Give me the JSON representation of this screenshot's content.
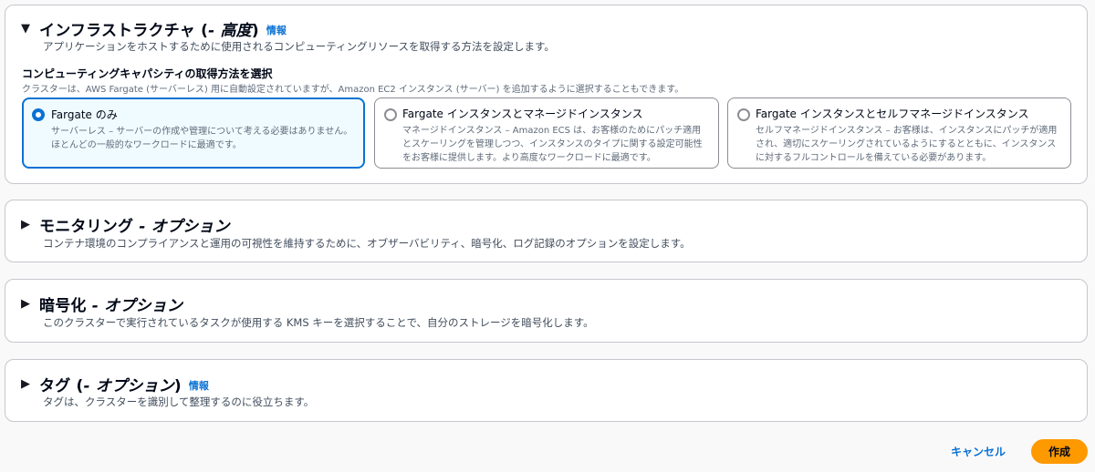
{
  "infrastructure": {
    "caret": "▼",
    "title": "インフラストラクチャ (",
    "title_opt": "- 高度",
    "title_close": ")",
    "info": "情報",
    "description": "アプリケーションをホストするために使用されるコンピューティングリソースを取得する方法を設定します。",
    "capacity_label": "コンピューティングキャパシティの取得方法を選択",
    "capacity_hint": "クラスターは、AWS Fargate (サーバーレス) 用に自動設定されていますが、Amazon EC2 インスタンス (サーバー) を追加するように選択することもできます。",
    "options": [
      {
        "title": "Fargate のみ",
        "description": "サーバーレス – サーバーの作成や管理について考える必要はありません。ほとんどの一般的なワークロードに最適です。",
        "selected": true
      },
      {
        "title": "Fargate インスタンスとマネージドインスタンス",
        "description": "マネージドインスタンス – Amazon ECS は、お客様のためにパッチ適用とスケーリングを管理しつつ、インスタンスのタイプに関する設定可能性をお客様に提供します。より高度なワークロードに最適です。",
        "selected": false
      },
      {
        "title": "Fargate インスタンスとセルフマネージドインスタンス",
        "description": "セルフマネージドインスタンス – お客様は、インスタンスにパッチが適用され、適切にスケーリングされているようにするとともに、インスタンスに対するフルコントロールを備えている必要があります。",
        "selected": false
      }
    ]
  },
  "monitoring": {
    "caret": "▶",
    "title": "モニタリング",
    "title_opt": " - オプション",
    "description": "コンテナ環境のコンプライアンスと運用の可視性を維持するために、オブザーバビリティ、暗号化、ログ記録のオプションを設定します。"
  },
  "encryption": {
    "caret": "▶",
    "title": "暗号化",
    "title_opt": " - オプション",
    "description": "このクラスターで実行されているタスクが使用する KMS キーを選択することで、自分のストレージを暗号化します。"
  },
  "tags": {
    "caret": "▶",
    "title": "タグ (",
    "title_opt": "- オプション",
    "title_close": ")",
    "info": "情報",
    "description": "タグは、クラスターを識別して整理するのに役立ちます。"
  },
  "footer": {
    "cancel_label": "キャンセル",
    "create_label": "作成"
  },
  "colors": {
    "accent": "#0972d3",
    "primary_button": "#ff9900",
    "selected_tile_bg": "#f0fbff"
  }
}
